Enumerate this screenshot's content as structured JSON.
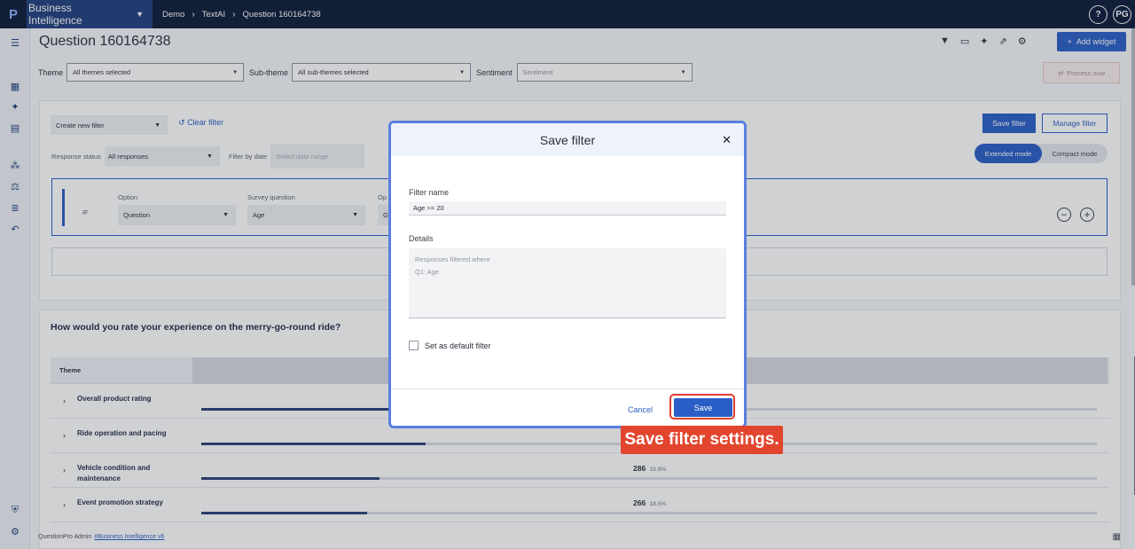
{
  "topbar": {
    "logo": "P",
    "app_name": "Business Intelligence",
    "breadcrumb": [
      "Demo",
      "TextAI",
      "Question 160164738"
    ],
    "help": "?",
    "avatar": "PG"
  },
  "page": {
    "title": "Question 160164738",
    "add_widget": "Add widget",
    "process_now": "Process now"
  },
  "filters": {
    "theme_label": "Theme",
    "theme_value": "All themes selected",
    "subtheme_label": "Sub-theme",
    "subtheme_value": "All sub-themes selected",
    "sentiment_label": "Sentiment",
    "sentiment_placeholder": "Sentiment"
  },
  "filter_panel": {
    "create_new": "Create new filter",
    "clear": "Clear filter",
    "save_filter": "Save filter",
    "manage_filter": "Manage filter",
    "extended_mode": "Extended mode",
    "compact_mode": "Compact mode",
    "response_status_label": "Response status",
    "response_status_value": "All responses",
    "filter_by_date_label": "Filter by date",
    "date_placeholder": "Select date range",
    "if": "IF",
    "option_label": "Option",
    "option_value": "Question",
    "survey_question_label": "Survey question",
    "survey_question_value": "Age",
    "operator_label_partial": "Op",
    "operator_value_partial": "G"
  },
  "question_card": {
    "title": "How would you rate your experience on the merry-go-round ride?",
    "theme_header": "Theme",
    "rows": [
      {
        "name": "Overall product rating",
        "count": "",
        "percent": "",
        "fill": 0.43
      },
      {
        "name": "Ride operation and pacing",
        "count": "",
        "percent": "",
        "fill": 0.25
      },
      {
        "name": "Vehicle condition and maintenance",
        "count": "286",
        "percent": "19.9%",
        "fill": 0.199
      },
      {
        "name": "Event promotion strategy",
        "count": "266",
        "percent": "18.5%",
        "fill": 0.185
      }
    ]
  },
  "footer": {
    "text": "QuestionPro Admin",
    "link": "#Business Intelligence v6"
  },
  "modal": {
    "title": "Save filter",
    "filter_name_label": "Filter name",
    "filter_name_value": "Age >= 20",
    "details_label": "Details",
    "details_line1": "Responses filtered where",
    "details_line2": "Q1: Age",
    "default_label": "Set as default filter",
    "cancel": "Cancel",
    "save": "Save"
  },
  "callout": {
    "text": "Save filter settings."
  },
  "colors": {
    "topbar": "#0c1b3a",
    "primary": "#2a5ec7",
    "callout": "#e2452e"
  }
}
